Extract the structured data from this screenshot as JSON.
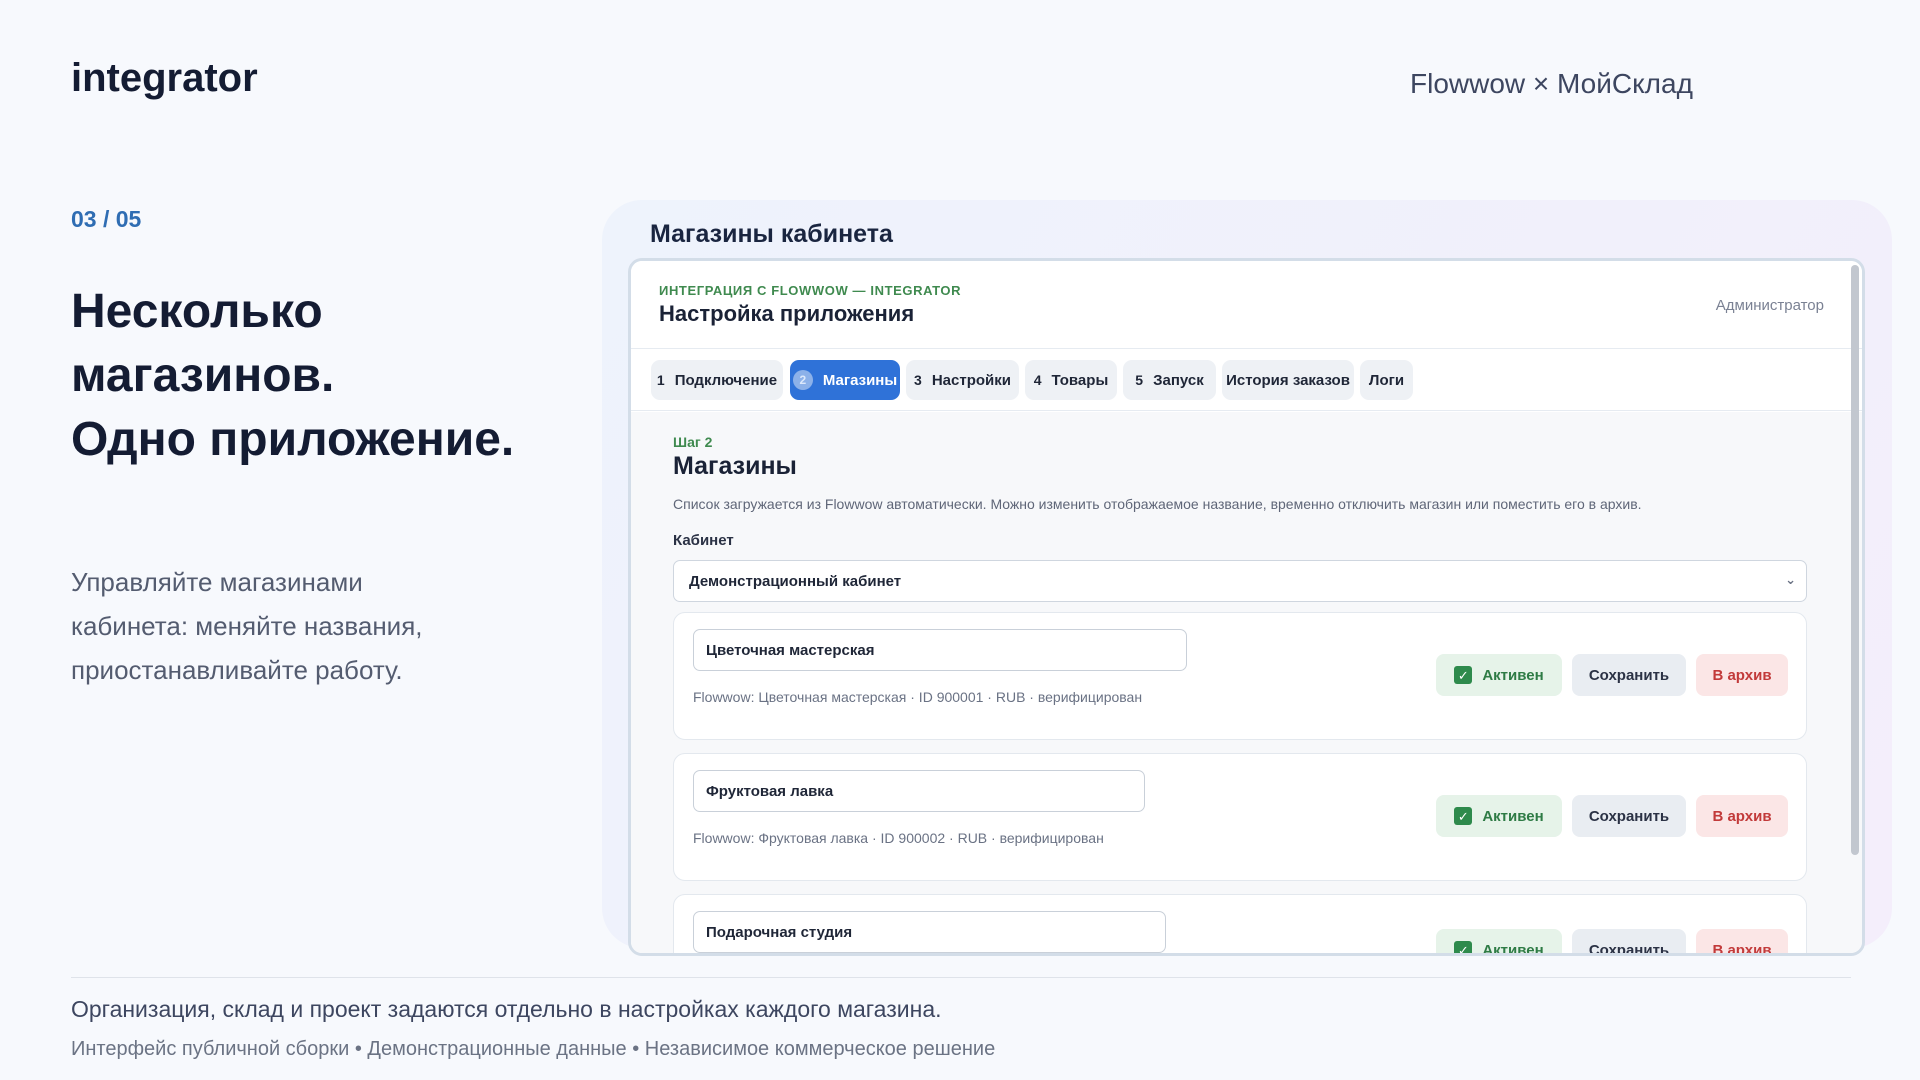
{
  "brand": "integrator",
  "partners": "Flowwow × МойСклад",
  "slide_counter": "03 / 05",
  "headline": [
    "Несколько",
    "магазинов.",
    "Одно приложение."
  ],
  "lead": [
    "Управляйте магазинами",
    "кабинета: меняйте названия,",
    "приостанавливайте работу."
  ],
  "stage_title": "Магазины кабинета",
  "app": {
    "eyebrow": "ИНТЕГРАЦИЯ С FLOWWOW — INTEGRATOR",
    "title": "Настройка приложения",
    "role": "Администратор",
    "tabs": [
      {
        "num": "1",
        "label": "Подключение",
        "active": false
      },
      {
        "num": "2",
        "label": "Магазины",
        "active": true
      },
      {
        "num": "3",
        "label": "Настройки",
        "active": false
      },
      {
        "num": "4",
        "label": "Товары",
        "active": false
      },
      {
        "num": "5",
        "label": "Запуск",
        "active": false
      },
      {
        "num": "",
        "label": "История заказов",
        "active": false
      },
      {
        "num": "",
        "label": "Логи",
        "active": false
      }
    ],
    "step": "Шаг 2",
    "section_title": "Магазины",
    "description": "Список загружается из Flowwow автоматически. Можно изменить отображаемое название, временно отключить магазин или поместить его в архив.",
    "cabinet_label": "Кабинет",
    "cabinet_value": "Демонстрационный кабинет",
    "stores": [
      {
        "name": "Цветочная мастерская",
        "meta": "Flowwow: Цветочная мастерская · ID 900001 · RUB · верифицирован",
        "active_label": "Активен",
        "save_label": "Сохранить",
        "archive_label": "В архив"
      },
      {
        "name": "Фруктовая лавка",
        "meta": "Flowwow: Фруктовая лавка · ID 900002 · RUB · верифицирован",
        "active_label": "Активен",
        "save_label": "Сохранить",
        "archive_label": "В архив"
      },
      {
        "name": "Подарочная студия",
        "meta": "",
        "active_label": "Активен",
        "save_label": "Сохранить",
        "archive_label": "В архив"
      }
    ]
  },
  "footer": {
    "main": "Организация, склад и проект задаются отдельно в настройках каждого магазина.",
    "sub": "Интерфейс публичной сборки • Демонстрационные данные • Независимое коммерческое решение"
  },
  "colors": {
    "accent_blue": "#2f72d8",
    "counter_blue": "#2f6db3",
    "success_green": "#2e7b45",
    "danger_red": "#c23a3a"
  }
}
